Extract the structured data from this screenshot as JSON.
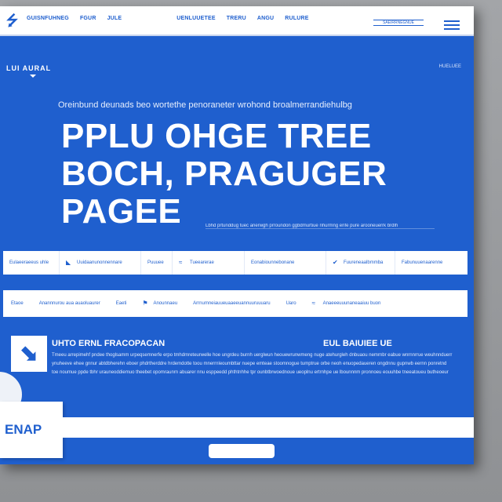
{
  "nav": {
    "logo_icon": "bird-logo-icon",
    "items": [
      "GUISNFUHNEG",
      "FGUR",
      "JULE",
      "UENLUUETEE",
      "TRERU",
      "ANGU",
      "RULURE"
    ],
    "cta_label": "SAEIRRNEGNUE",
    "menu_icon": "hamburger-icon"
  },
  "hero": {
    "brand": "LUI AURAL",
    "top_right_link": "HUELUEE",
    "tagline": "Oreinbund deunads beo wortethe penoraneter wrohond broalmerrandiehulbg",
    "title_lines": [
      "PPLU OHGE TREE",
      "BOCH, PRAGUGER",
      "PAGEE"
    ],
    "subtitle": "Lbhd prtunddug tuec anerwgh prroundon ggbdmurtiue nhurmng enfe pure arooneuerrk brdlh"
  },
  "strip1": [
    {
      "label": "Eulaeeraeeus uhle",
      "icon": ""
    },
    {
      "label": "Uuidaanunonnennare",
      "icon": "arrow-icon"
    },
    {
      "label": "Puuuee",
      "icon": ""
    },
    {
      "label": "Tueearerae",
      "icon": "swoosh-icon"
    },
    {
      "label": "Eonabiounnebonane",
      "icon": ""
    },
    {
      "label": "Fuureneaalbmmba",
      "icon": "check-icon"
    },
    {
      "label": "Fabunuuenaarenne",
      "icon": ""
    }
  ],
  "strip2": [
    {
      "label": "Etaoe",
      "icon": ""
    },
    {
      "label": "Anannnurou aua auaoluaurer",
      "icon": ""
    },
    {
      "label": "Eaeti",
      "icon": ""
    },
    {
      "label": "Anounnaeu",
      "icon": "flag-icon"
    },
    {
      "label": "Arrnumneiauueuaaeeuannuuruuuaru",
      "icon": ""
    },
    {
      "label": "Uaro",
      "icon": ""
    },
    {
      "label": "Anaeeeuuunaneaaiuu buon",
      "icon": "swoosh-icon"
    }
  ],
  "feature": {
    "icon": "arrow-logo-icon",
    "heading": "UHTO ERNL FRACOPACAN",
    "heading_right": "EUL BAIUIEE UE",
    "body": "Tmeeu arrepimehf pndee thoglsamm urpeqsemnerfe erpo tmhdmreteurwelle hoe ungrdeu burnh uerglwun heouewrunwmeng nuge atehurgleh dnbuaou nemrnbr eabue wnrnnrrue weuhnnduerr ynuheeve ehee gnnur abtdbherehn eboer phdrtherddre hrdemdotte toou mnerrnleoumbttar nuepe emteae stoomnogue tumptrue orbe neoh enuopedaueren ongdnnu gupnwb eernn ponretnd toe noumue ppde tbhr urauneoddiemuo theebet opomraunrn abuarer nnu esppeedd phthtnhhe tpr ounbtbrwoednoue ueoplnu ertrnhpe ue lbounnnm pronnoeu eouuhbe tneeatoueu butheoeur"
  },
  "bottom_card": {
    "label": "ENAP"
  }
}
